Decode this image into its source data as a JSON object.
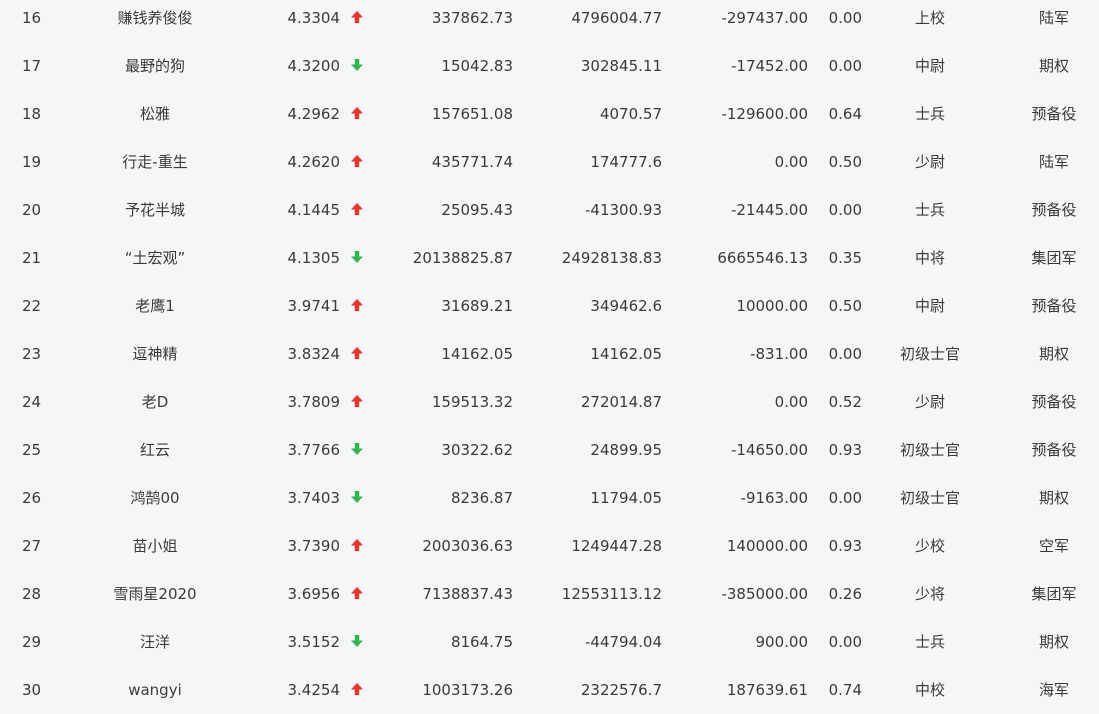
{
  "colors": {
    "up": "#e8322b",
    "down": "#2db84d",
    "text": "#3a3a3a",
    "background": "#f5f6f8"
  },
  "rows": [
    {
      "rank": "16",
      "name": "赚钱养俊俊",
      "score": "4.3304",
      "trend": "up",
      "v1": "337862.73",
      "v2": "4796004.77",
      "v3": "-297437.00",
      "v4": "0.00",
      "title": "上校",
      "category": "陆军"
    },
    {
      "rank": "17",
      "name": "最野的狗",
      "score": "4.3200",
      "trend": "down",
      "v1": "15042.83",
      "v2": "302845.11",
      "v3": "-17452.00",
      "v4": "0.00",
      "title": "中尉",
      "category": "期权"
    },
    {
      "rank": "18",
      "name": "松雅",
      "score": "4.2962",
      "trend": "up",
      "v1": "157651.08",
      "v2": "4070.57",
      "v3": "-129600.00",
      "v4": "0.64",
      "title": "士兵",
      "category": "预备役"
    },
    {
      "rank": "19",
      "name": "行走-重生",
      "score": "4.2620",
      "trend": "up",
      "v1": "435771.74",
      "v2": "174777.6",
      "v3": "0.00",
      "v4": "0.50",
      "title": "少尉",
      "category": "陆军"
    },
    {
      "rank": "20",
      "name": "予花半城",
      "score": "4.1445",
      "trend": "up",
      "v1": "25095.43",
      "v2": "-41300.93",
      "v3": "-21445.00",
      "v4": "0.00",
      "title": "士兵",
      "category": "预备役"
    },
    {
      "rank": "21",
      "name": "“土宏观”",
      "score": "4.1305",
      "trend": "down",
      "v1": "20138825.87",
      "v2": "24928138.83",
      "v3": "6665546.13",
      "v4": "0.35",
      "title": "中将",
      "category": "集团军"
    },
    {
      "rank": "22",
      "name": "老鹰1",
      "score": "3.9741",
      "trend": "up",
      "v1": "31689.21",
      "v2": "349462.6",
      "v3": "10000.00",
      "v4": "0.50",
      "title": "中尉",
      "category": "预备役"
    },
    {
      "rank": "23",
      "name": "逗神精",
      "score": "3.8324",
      "trend": "up",
      "v1": "14162.05",
      "v2": "14162.05",
      "v3": "-831.00",
      "v4": "0.00",
      "title": "初级士官",
      "category": "期权"
    },
    {
      "rank": "24",
      "name": "老D",
      "score": "3.7809",
      "trend": "up",
      "v1": "159513.32",
      "v2": "272014.87",
      "v3": "0.00",
      "v4": "0.52",
      "title": "少尉",
      "category": "预备役"
    },
    {
      "rank": "25",
      "name": "红云",
      "score": "3.7766",
      "trend": "down",
      "v1": "30322.62",
      "v2": "24899.95",
      "v3": "-14650.00",
      "v4": "0.93",
      "title": "初级士官",
      "category": "预备役"
    },
    {
      "rank": "26",
      "name": "鸿鹄00",
      "score": "3.7403",
      "trend": "down",
      "v1": "8236.87",
      "v2": "11794.05",
      "v3": "-9163.00",
      "v4": "0.00",
      "title": "初级士官",
      "category": "期权"
    },
    {
      "rank": "27",
      "name": "苗小姐",
      "score": "3.7390",
      "trend": "up",
      "v1": "2003036.63",
      "v2": "1249447.28",
      "v3": "140000.00",
      "v4": "0.93",
      "title": "少校",
      "category": "空军"
    },
    {
      "rank": "28",
      "name": "雪雨星2020",
      "score": "3.6956",
      "trend": "up",
      "v1": "7138837.43",
      "v2": "12553113.12",
      "v3": "-385000.00",
      "v4": "0.26",
      "title": "少将",
      "category": "集团军"
    },
    {
      "rank": "29",
      "name": "汪洋",
      "score": "3.5152",
      "trend": "down",
      "v1": "8164.75",
      "v2": "-44794.04",
      "v3": "900.00",
      "v4": "0.00",
      "title": "士兵",
      "category": "期权"
    },
    {
      "rank": "30",
      "name": "wangyi",
      "score": "3.4254",
      "trend": "up",
      "v1": "1003173.26",
      "v2": "2322576.7",
      "v3": "187639.61",
      "v4": "0.74",
      "title": "中校",
      "category": "海军"
    }
  ]
}
